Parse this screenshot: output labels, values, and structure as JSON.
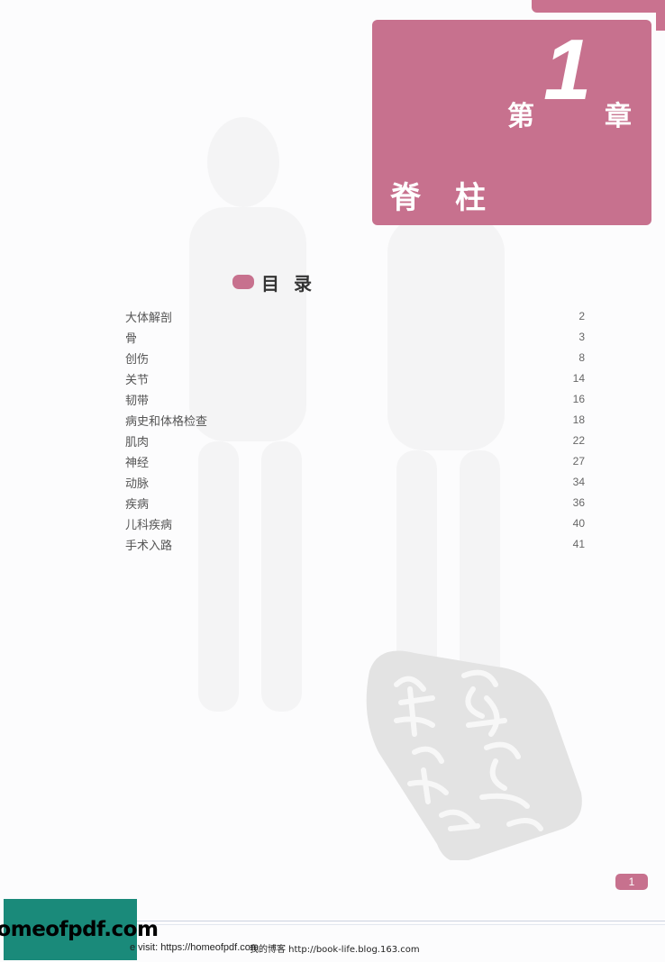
{
  "chapter": {
    "prefix": "第",
    "number": "1",
    "suffix": "章",
    "title": "脊柱"
  },
  "toc": {
    "heading": "目录",
    "entries": [
      {
        "label": "大体解剖",
        "page": "2"
      },
      {
        "label": "骨",
        "page": "3"
      },
      {
        "label": "创伤",
        "page": "8"
      },
      {
        "label": "关节",
        "page": "14"
      },
      {
        "label": "韧带",
        "page": "16"
      },
      {
        "label": "病史和体格检查",
        "page": "18"
      },
      {
        "label": "肌肉",
        "page": "22"
      },
      {
        "label": "神经",
        "page": "27"
      },
      {
        "label": "动脉",
        "page": "34"
      },
      {
        "label": "疾病",
        "page": "36"
      },
      {
        "label": "儿科疾病",
        "page": "40"
      },
      {
        "label": "手术入路",
        "page": "41"
      }
    ]
  },
  "page_number": "1",
  "seal": {
    "text": "藏书印"
  },
  "watermark": {
    "text": "homeofpdf.com"
  },
  "footer": {
    "visit_text": "e visit: https://homeofpdf.com",
    "blog_text": "我的博客 http://book-life.blog.163.com"
  },
  "colors": {
    "accent": "#c7718e",
    "watermark_bg": "#1a8a7a"
  }
}
